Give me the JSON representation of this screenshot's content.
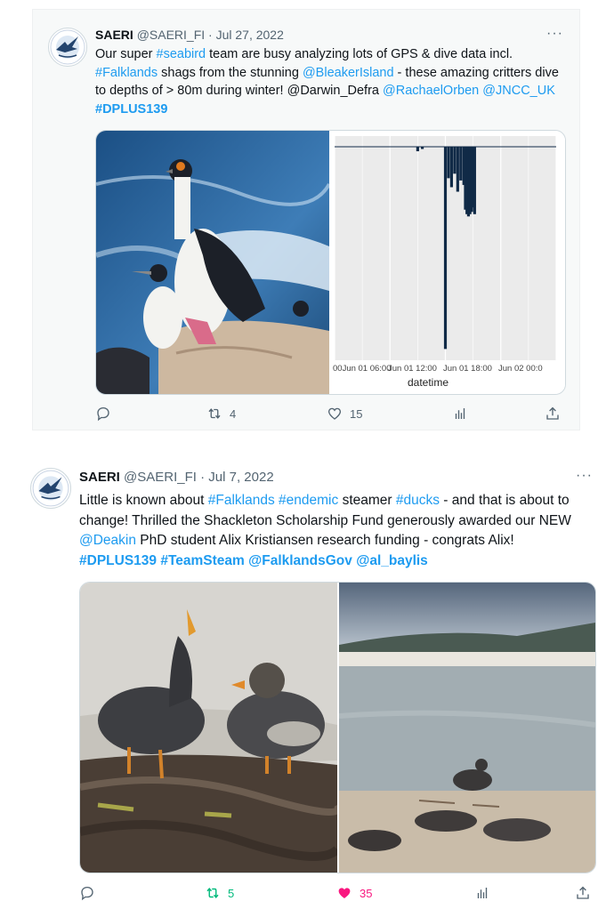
{
  "tweets": [
    {
      "name": "SAERI",
      "handle": "@SAERI_FI",
      "date": "Jul 27, 2022",
      "text": [
        {
          "t": "Our super ",
          "k": "p"
        },
        {
          "t": "#seabird",
          "k": "l"
        },
        {
          "t": " team are busy analyzing lots of GPS & dive data incl. ",
          "k": "p"
        },
        {
          "t": "#Falklands",
          "k": "l"
        },
        {
          "t": " shags from the stunning ",
          "k": "p"
        },
        {
          "t": "@BleakerIsland",
          "k": "l"
        },
        {
          "t": " -  these amazing critters dive to depths of > 80m during winter! @Darwin_Defra ",
          "k": "p"
        },
        {
          "t": "@RachaelOrben",
          "k": "l"
        },
        {
          "t": " ",
          "k": "p"
        },
        {
          "t": "@JNCC_UK",
          "k": "l"
        },
        {
          "t": " ",
          "k": "p"
        },
        {
          "t": "#DPLUS139",
          "k": "lb"
        }
      ],
      "reply_count": "",
      "retweet_count": "4",
      "like_count": "15",
      "liked": false
    },
    {
      "name": "SAERI",
      "handle": "@SAERI_FI",
      "date": "Jul 7, 2022",
      "text": [
        {
          "t": "Little is known about ",
          "k": "p"
        },
        {
          "t": "#Falklands",
          "k": "l"
        },
        {
          "t": " ",
          "k": "p"
        },
        {
          "t": "#endemic",
          "k": "l"
        },
        {
          "t": " steamer ",
          "k": "p"
        },
        {
          "t": "#ducks",
          "k": "l"
        },
        {
          "t": " - and that is about to change! Thrilled the Shackleton Scholarship Fund generously awarded our NEW ",
          "k": "p"
        },
        {
          "t": "@Deakin",
          "k": "l"
        },
        {
          "t": " PhD student Alix Kristiansen research funding - congrats Alix! ",
          "k": "p"
        },
        {
          "t": "#DPLUS139",
          "k": "lb"
        },
        {
          "t": " ",
          "k": "p"
        },
        {
          "t": "#TeamSteam",
          "k": "lb"
        },
        {
          "t": " ",
          "k": "p"
        },
        {
          "t": "@FalklandsGov",
          "k": "lb"
        },
        {
          "t": " ",
          "k": "p"
        },
        {
          "t": "@al_baylis",
          "k": "lb"
        }
      ],
      "reply_count": "",
      "retweet_count": "5",
      "like_count": "35",
      "liked": true
    }
  ],
  "dive_chart": {
    "xlabel": "datetime",
    "xticks": [
      "00Jun 01 06:00",
      "Jun 01 12:00",
      "Jun 01 18:00",
      "Jun 02 00:0"
    ]
  },
  "chart_data": {
    "type": "bar",
    "title": "",
    "xlabel": "datetime",
    "ylabel": "",
    "x": [
      "Jun 01 09:00",
      "Jun 01 09:30",
      "Jun 01 12:00",
      "Jun 01 12:20",
      "Jun 01 12:40",
      "Jun 01 13:00",
      "Jun 01 13:20",
      "Jun 01 13:40",
      "Jun 01 14:00",
      "Jun 01 14:10",
      "Jun 01 14:20",
      "Jun 01 14:30",
      "Jun 01 14:40",
      "Jun 01 14:50",
      "Jun 01 15:00",
      "Jun 01 15:10"
    ],
    "values": [
      -2,
      -1,
      -90,
      -14,
      -18,
      -12,
      -20,
      -15,
      -17,
      -28,
      -30,
      -31,
      -30,
      -29,
      -27,
      -30
    ],
    "ylim": [
      -95,
      2
    ],
    "xlim": [
      "Jun 01 00:00",
      "Jun 02 00:00"
    ],
    "grid": true,
    "colors": {
      "bar": "#102a47",
      "bg": "#ebebeb"
    }
  },
  "icons": {
    "reply": "reply-icon",
    "retweet": "retweet-icon",
    "like": "heart-icon",
    "views": "analytics-icon",
    "share": "share-icon",
    "more": "more-icon"
  },
  "colors": {
    "link": "#1d9bf0",
    "muted": "#536471",
    "retweet_active": "#00ba7c",
    "like_active": "#f91880"
  },
  "more_glyph": "···"
}
